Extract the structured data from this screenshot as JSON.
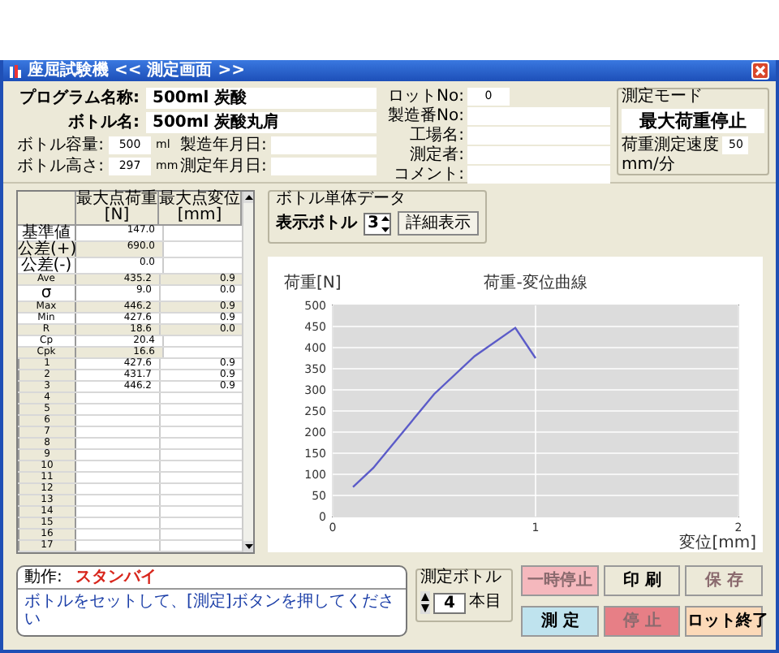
{
  "window": {
    "title": "座屈試験機 << 測定画面 >>"
  },
  "program": {
    "label": "プログラム名称:",
    "value": "500ml 炭酸"
  },
  "bottle": {
    "label": "ボトル名:",
    "value": "500ml 炭酸丸肩"
  },
  "capacity": {
    "label": "ボトル容量:",
    "value": "500",
    "unit": "ml"
  },
  "height": {
    "label": "ボトル高さ:",
    "value": "297",
    "unit": "mm"
  },
  "dates": [
    {
      "label": "製造年月日:"
    },
    {
      "label": "測定年月日:"
    }
  ],
  "lot_fields": [
    {
      "label": "ロットNo:",
      "value": "0"
    },
    {
      "label": "製造番No:"
    },
    {
      "label": "工場名:"
    },
    {
      "label": "測定者:"
    },
    {
      "label": "コメント:"
    }
  ],
  "mode": {
    "legend": "測定モード",
    "value": "最大荷重停止",
    "speed_label": "荷重測定速度",
    "speed": "50",
    "speed_unit": "mm/分"
  },
  "table": {
    "columns": [
      "最大点荷重[N]",
      "最大点変位[mm]"
    ],
    "rows": [
      {
        "kind": "stat",
        "label": "基準値",
        "load": "147.0"
      },
      {
        "kind": "stat",
        "label": "公差(+)",
        "load": "690.0"
      },
      {
        "kind": "stat",
        "label": "公差(-)",
        "load": "0.0"
      },
      {
        "kind": "stat",
        "label": "Ave",
        "load": "435.2",
        "disp": "0.9"
      },
      {
        "kind": "stat",
        "label": "σ",
        "load": "9.0",
        "disp": "0.0"
      },
      {
        "kind": "stat",
        "label": "Max",
        "load": "446.2",
        "disp": "0.9"
      },
      {
        "kind": "stat",
        "label": "Min",
        "load": "427.6",
        "disp": "0.9"
      },
      {
        "kind": "stat",
        "label": "R",
        "load": "18.6",
        "disp": "0.0"
      },
      {
        "kind": "stat",
        "label": "Cp",
        "load": "20.4"
      },
      {
        "kind": "stat",
        "label": "Cpk",
        "load": "16.6"
      },
      {
        "kind": "sample",
        "label": "1",
        "load": "427.6",
        "disp": "0.9"
      },
      {
        "kind": "sample",
        "label": "2",
        "load": "431.7",
        "disp": "0.9"
      },
      {
        "kind": "sample",
        "label": "3",
        "load": "446.2",
        "disp": "0.9"
      },
      {
        "kind": "sample",
        "label": "4"
      },
      {
        "kind": "sample",
        "label": "5"
      },
      {
        "kind": "sample",
        "label": "6"
      },
      {
        "kind": "sample",
        "label": "7"
      },
      {
        "kind": "sample",
        "label": "8"
      },
      {
        "kind": "sample",
        "label": "9"
      },
      {
        "kind": "sample",
        "label": "10"
      },
      {
        "kind": "sample",
        "label": "11"
      },
      {
        "kind": "sample",
        "label": "12"
      },
      {
        "kind": "sample",
        "label": "13"
      },
      {
        "kind": "sample",
        "label": "14"
      },
      {
        "kind": "sample",
        "label": "15"
      },
      {
        "kind": "sample",
        "label": "16"
      },
      {
        "kind": "sample",
        "label": "17"
      }
    ]
  },
  "single": {
    "legend": "ボトル単体データ",
    "label": "表示ボトル",
    "value": "3",
    "button": "詳細表示"
  },
  "chart": {
    "chart_data": {
      "type": "line",
      "title": "荷重-変位曲線",
      "xlabel": "変位[mm]",
      "ylabel": "荷重[N]",
      "x": [
        0.1,
        0.2,
        0.5,
        0.7,
        0.9,
        1.0
      ],
      "series": [
        {
          "color": "#5b5bc8",
          "values": [
            70,
            115,
            290,
            380,
            447,
            375
          ]
        }
      ],
      "grid": true,
      "xlim": [
        0,
        2
      ],
      "ylim": [
        0,
        500
      ],
      "xticks": [
        0,
        1,
        2
      ],
      "yticks": [
        0,
        50,
        100,
        150,
        200,
        250,
        300,
        350,
        400,
        450,
        500
      ]
    }
  },
  "status": {
    "label": "動作:",
    "value": "スタンバイ",
    "message": "ボトルをセットして、[測定]ボタンを押してください"
  },
  "measure_bottle": {
    "legend": "測定ボトル",
    "value": "4",
    "unit": "本目"
  },
  "buttons": [
    {
      "label": "一時停止",
      "color": "#f5b8bd",
      "disabled": true
    },
    {
      "label": "印 刷",
      "color": "#ece9d8",
      "disabled": false
    },
    {
      "label": "保 存",
      "color": "#ece9d8",
      "disabled": true
    },
    {
      "label": "測 定",
      "color": "#bfe3ee",
      "disabled": false
    },
    {
      "label": "停 止",
      "color": "#e77f86",
      "disabled": true
    },
    {
      "label": "ロット終了",
      "color": "#fcd9b8",
      "disabled": false
    }
  ]
}
